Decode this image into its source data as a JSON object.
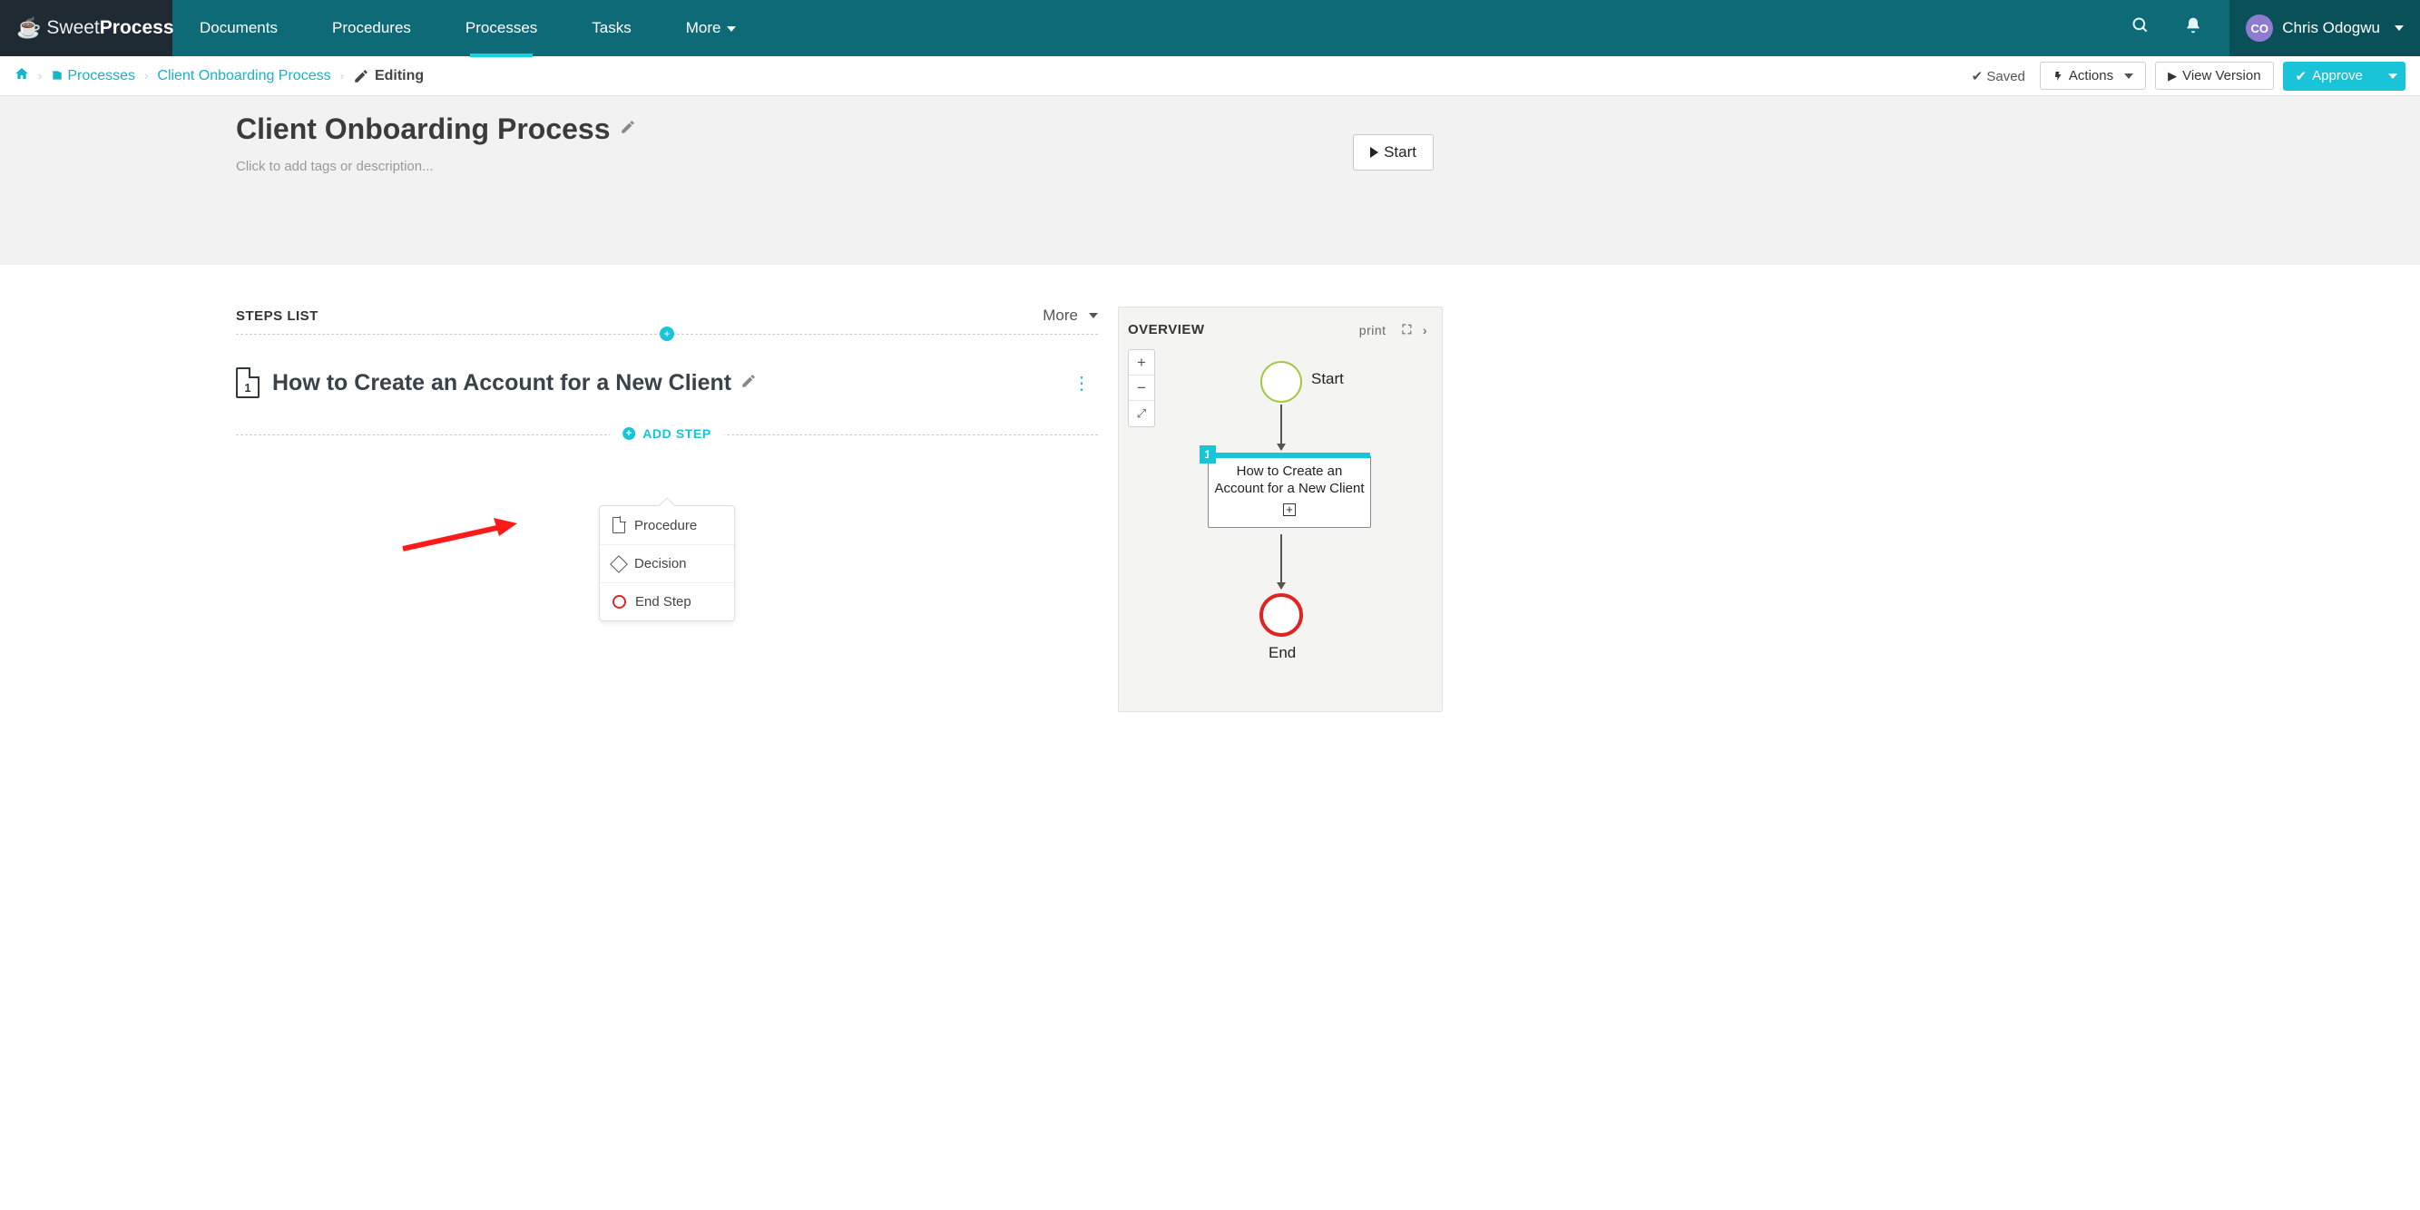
{
  "brand": {
    "sweet": "Sweet",
    "process": "Process"
  },
  "nav": {
    "documents": "Documents",
    "procedures": "Procedures",
    "processes": "Processes",
    "tasks": "Tasks",
    "more": "More"
  },
  "user": {
    "initials": "CO",
    "name": "Chris Odogwu"
  },
  "breadcrumb": {
    "processes": "Processes",
    "process_name": "Client Onboarding Process",
    "editing": "Editing"
  },
  "toolbar": {
    "saved": "Saved",
    "actions": "Actions",
    "view_version": "View Version",
    "approve": "Approve"
  },
  "page": {
    "title": "Client Onboarding Process",
    "tags_hint": "Click to add tags or description...",
    "start": "Start"
  },
  "steps": {
    "heading": "STEPS LIST",
    "more": "More",
    "step1_num": "1",
    "step1_title": "How to Create an Account for a New Client",
    "addstep": "ADD STEP",
    "popover": {
      "procedure": "Procedure",
      "decision": "Decision",
      "endstep": "End Step"
    }
  },
  "overview": {
    "heading": "OVERVIEW",
    "print": "print",
    "start": "Start",
    "node1_num": "1",
    "node1_text": "How to Create an Account for a New Client",
    "end": "End"
  }
}
